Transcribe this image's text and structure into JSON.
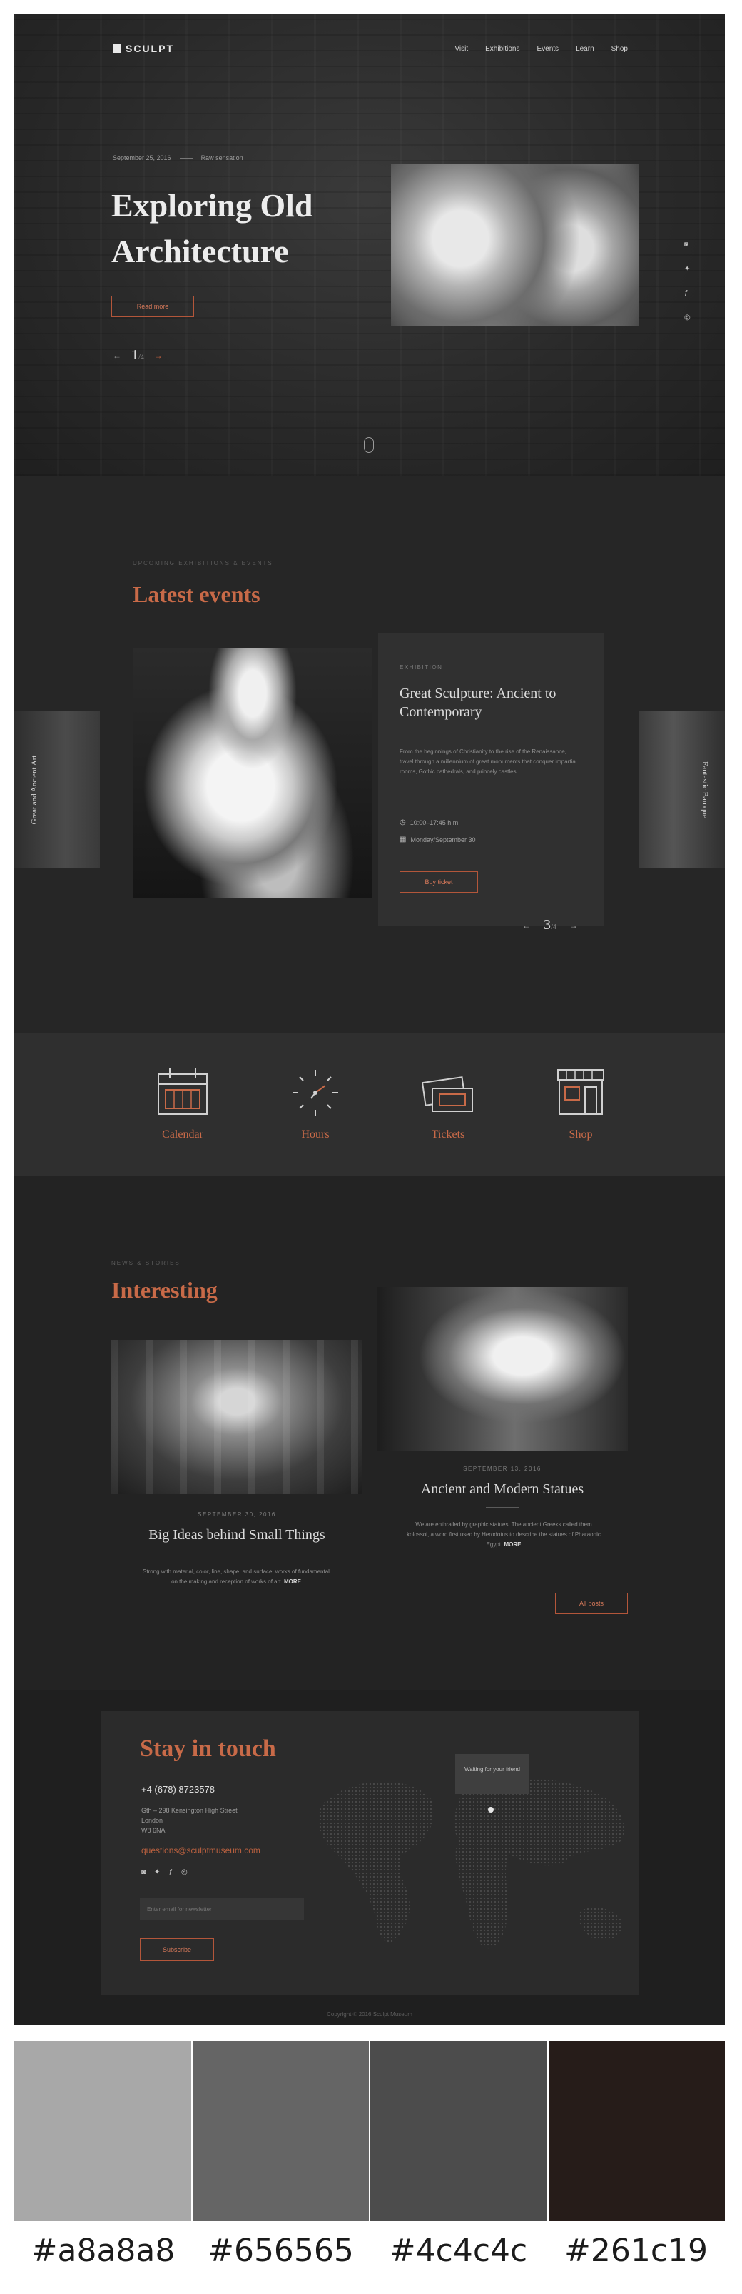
{
  "brand": {
    "logo": "SCULPT"
  },
  "nav": [
    "Visit",
    "Exhibitions",
    "Events",
    "Learn",
    "Shop"
  ],
  "hero": {
    "date": "September 25, 2016",
    "category": "Raw sensation",
    "title": "Exploring Old Architecture",
    "button": "Read more",
    "slide_current": "1",
    "slide_total": "/4",
    "prev": "←",
    "next": "→"
  },
  "social_icons": [
    "instagram-icon",
    "twitter-icon",
    "facebook-icon",
    "dribbble-icon"
  ],
  "events": {
    "eyebrow": "UPCOMING EXHIBITIONS & EVENTS",
    "title": "Latest events",
    "card": {
      "category": "EXHIBITION",
      "name": "Great Sculpture: Ancient to Contemporary",
      "description": "From the beginnings of Christianity to the rise of the Renaissance, travel through a millennium of great monuments that conquer impartial rooms, Gothic cathedrals, and princely castles.",
      "time": "10:00–17:45 h.m.",
      "date": "Monday/September 30",
      "button": "Buy ticket"
    },
    "left_card": "Great and Ancient Art",
    "right_card": "Fantastic Baroque",
    "pager_current": "3",
    "pager_total": "/4",
    "prev": "←",
    "next": "→"
  },
  "features": [
    {
      "label": "Calendar",
      "icon": "calendar-icon"
    },
    {
      "label": "Hours",
      "icon": "clock-icon"
    },
    {
      "label": "Tickets",
      "icon": "tickets-icon"
    },
    {
      "label": "Shop",
      "icon": "shop-icon"
    }
  ],
  "interesting": {
    "eyebrow": "NEWS & STORIES",
    "title": "Interesting",
    "article1": {
      "date": "SEPTEMBER 30, 2016",
      "title": "Big Ideas behind Small Things",
      "description": "Strong with material, color, line, shape, and surface, works of fundamental on the making and reception of works of art.",
      "more": "MORE"
    },
    "article2": {
      "date": "SEPTEMBER 13, 2016",
      "title": "Ancient and Modern Statues",
      "description": "We are enthralled by graphic statues. The ancient Greeks called them kolossoi, a word first used by Herodotus to describe the statues of Pharaonic Egypt.",
      "more": "MORE"
    },
    "all_button": "All posts"
  },
  "contact": {
    "title": "Stay in touch",
    "phone": "+4 (678) 8723578",
    "address_line1": "Gth – 298 Kensington High Street",
    "address_line2": "London",
    "address_line3": "W8 6NA",
    "email": "questions@sculptmuseum.com",
    "input_placeholder": "Enter email for newsletter",
    "button": "Subscribe",
    "tooltip": "Waiting for your friend"
  },
  "copyright": "Copyright © 2016 Sculpt Museum",
  "palette": [
    {
      "hex": "#a8a8a8",
      "color": "#a8a8a8"
    },
    {
      "hex": "#656565",
      "color": "#656565"
    },
    {
      "hex": "#4c4c4c",
      "color": "#4c4c4c"
    },
    {
      "hex": "#261c19",
      "color": "#261c19"
    }
  ],
  "accent_color": "#c86a48"
}
